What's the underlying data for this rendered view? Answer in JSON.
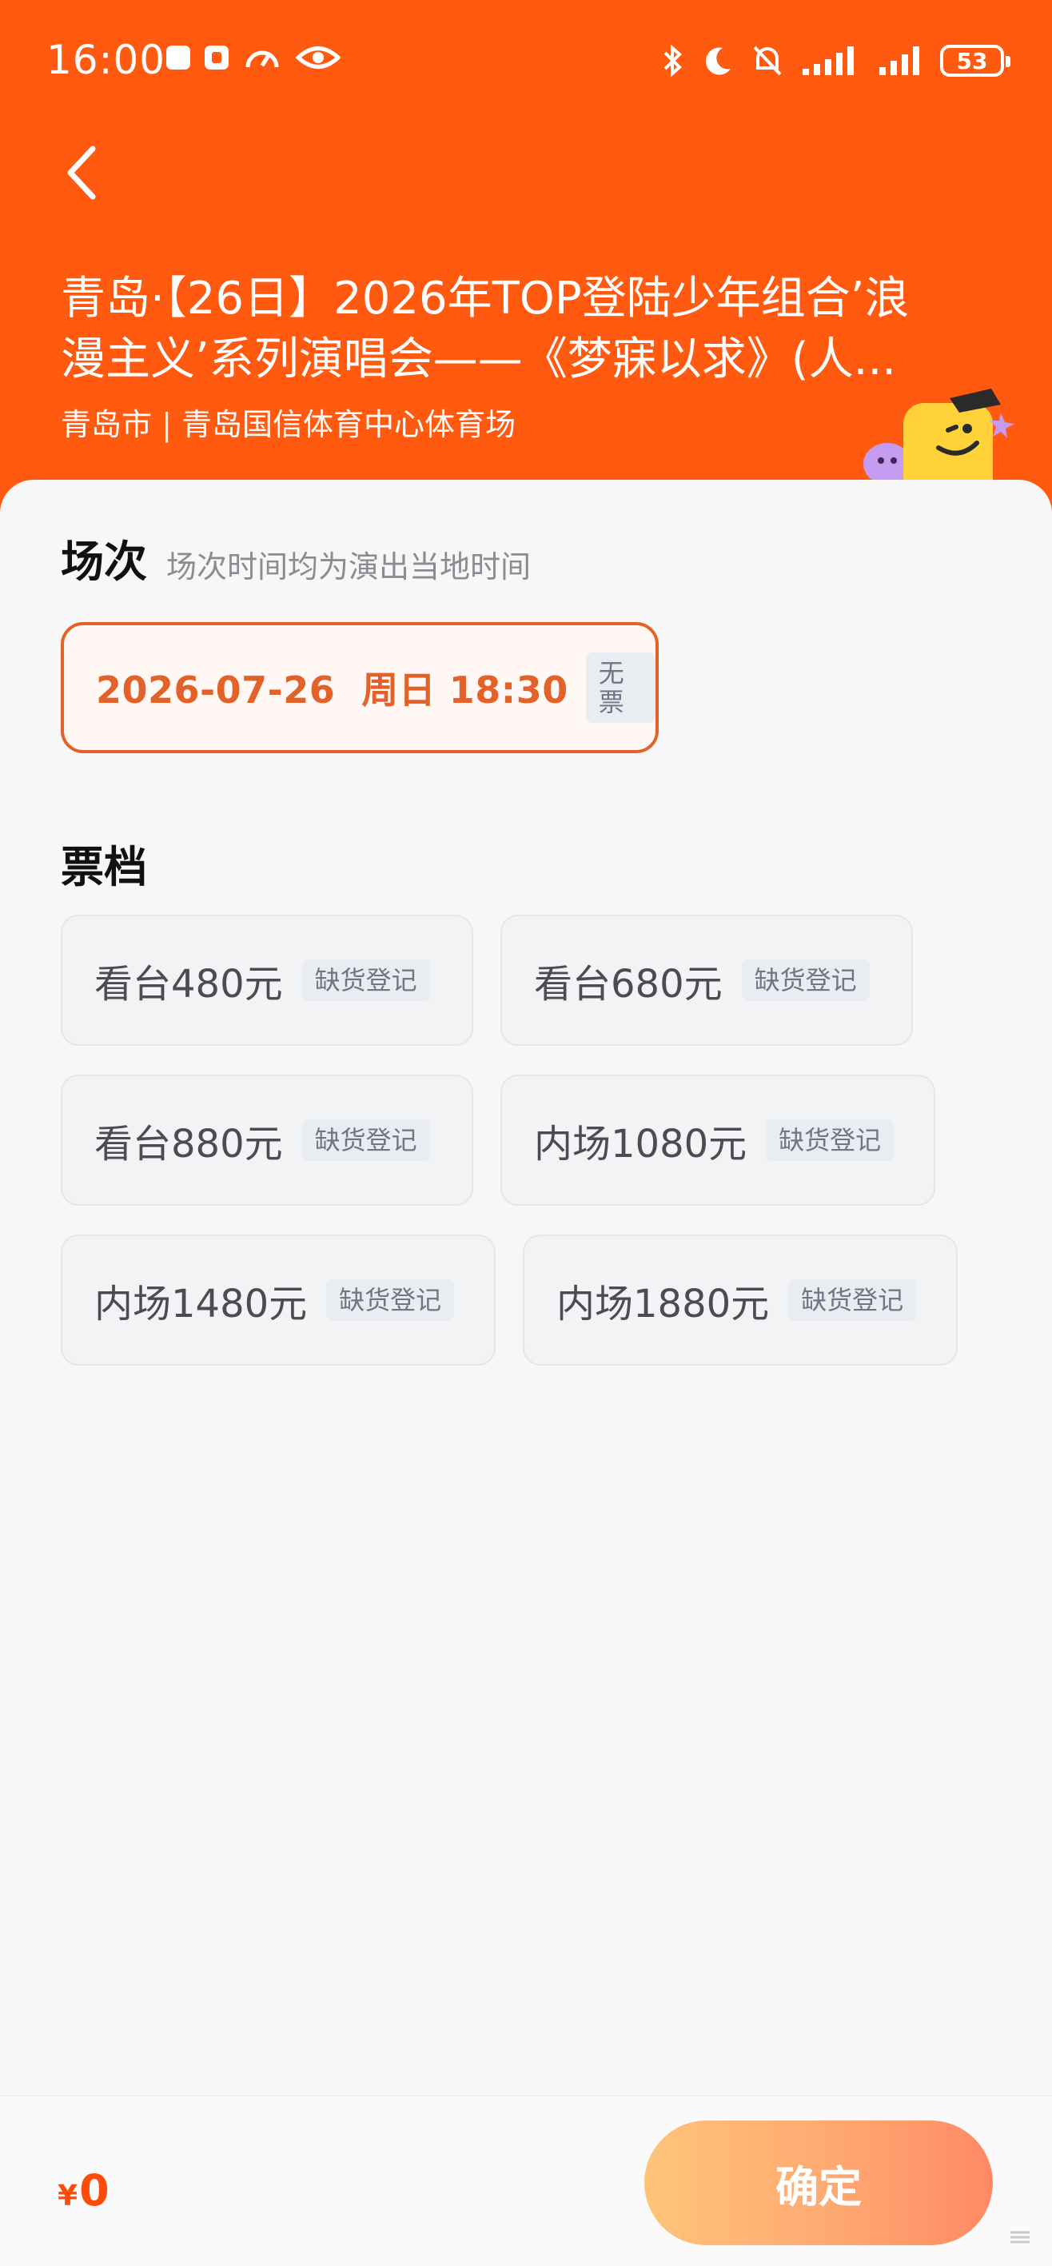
{
  "status_bar": {
    "time": "16:00",
    "battery": "53"
  },
  "event": {
    "title_line1": "青岛·【26日】2026年TOP登陆少年组合’浪",
    "title_line2": "漫主义’系列演唱会——《梦寐以求》(人...",
    "venue": "青岛市 | 青岛国信体育中心体育场"
  },
  "session": {
    "heading": "场次",
    "note": "场次时间均为演出当地时间",
    "selected_label": "2026-07-26  周日 18:30",
    "selected_tag": "无票"
  },
  "tickets": {
    "heading": "票档",
    "tiers": [
      {
        "price": "看台480元",
        "tag": "缺货登记"
      },
      {
        "price": "看台680元",
        "tag": "缺货登记"
      },
      {
        "price": "看台880元",
        "tag": "缺货登记"
      },
      {
        "price": "内场1080元",
        "tag": "缺货登记"
      },
      {
        "price": "内场1480元",
        "tag": "缺货登记"
      },
      {
        "price": "内场1880元",
        "tag": "缺货登记"
      }
    ]
  },
  "footer": {
    "currency": "¥",
    "total": "0",
    "confirm_label": "确定"
  },
  "colors": {
    "header_bg": "#ff5a0f",
    "accent": "#e2622a",
    "price": "#ff4b0a"
  },
  "icons": [
    "back-arrow-icon",
    "bluetooth-icon",
    "moon-icon",
    "mute-bell-icon",
    "signal-icon",
    "battery-icon",
    "eye-icon",
    "speedometer-icon"
  ]
}
